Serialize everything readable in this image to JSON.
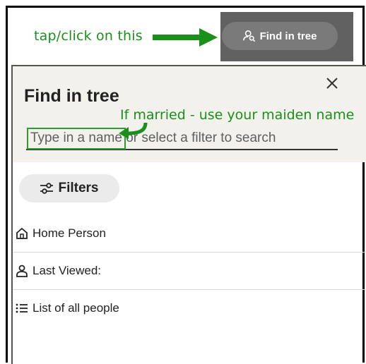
{
  "instructions": {
    "tap_text": "tap/click on this",
    "married_note": "If married - use your maiden name",
    "annotation_color": "#1a8f1a"
  },
  "top_button": {
    "label": "Find in tree",
    "icon": "person-search-icon"
  },
  "panel": {
    "title": "Find in tree",
    "close_icon": "close-icon",
    "search_placeholder": "Type in a name or select a filter to search",
    "filters_label": "Filters",
    "filters_icon": "sliders-icon",
    "items": [
      {
        "label": "Home Person",
        "icon": "home-icon"
      },
      {
        "label": "Last Viewed:",
        "icon": "person-icon"
      },
      {
        "label": "List of all people",
        "icon": "list-icon"
      }
    ]
  }
}
